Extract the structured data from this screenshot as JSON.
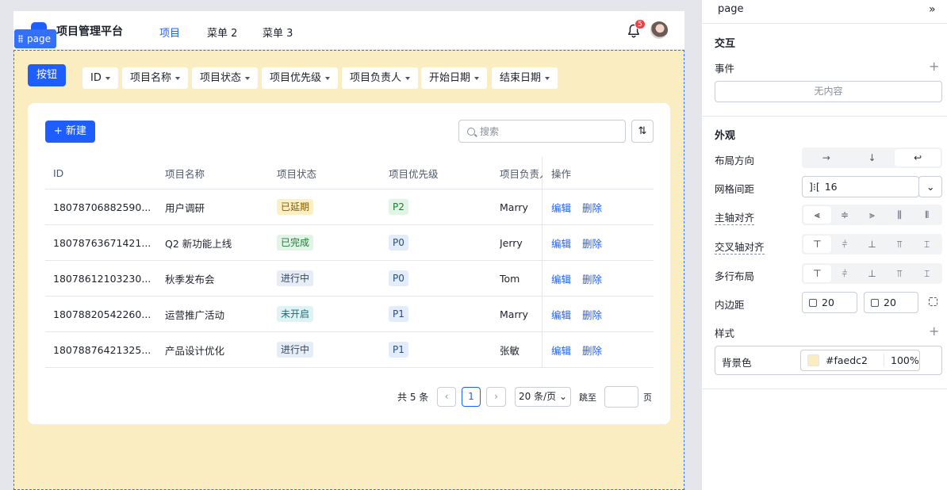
{
  "app": {
    "brand": "项目管理平台",
    "nav": [
      "项目",
      "菜单 2",
      "菜单 3"
    ],
    "active_nav": 0,
    "notification_count": "5"
  },
  "selection": {
    "tag": "page"
  },
  "toolbar": {
    "primary_button": "按钮",
    "filters": [
      "ID",
      "项目名称",
      "项目状态",
      "项目优先级",
      "项目负责人",
      "开始日期",
      "结束日期"
    ]
  },
  "table": {
    "new_button": "+ 新建",
    "search_placeholder": "搜索",
    "sort_icon": "⇅",
    "columns": [
      "ID",
      "项目名称",
      "项目状态",
      "项目优先级",
      "项目负责人",
      "操作"
    ],
    "rows": [
      {
        "id": "18078706882590...",
        "name": "用户调研",
        "status": "已延期",
        "status_type": "delay",
        "priority": "P2",
        "owner": "Marry",
        "edit": "编辑",
        "delete": "删除"
      },
      {
        "id": "18078763671421...",
        "name": "Q2 新功能上线",
        "status": "已完成",
        "status_type": "done",
        "priority": "P0",
        "owner": "Jerry",
        "edit": "编辑",
        "delete": "删除"
      },
      {
        "id": "18078612103230...",
        "name": "秋季发布会",
        "status": "进行中",
        "status_type": "doing",
        "priority": "P0",
        "owner": "Tom",
        "edit": "编辑",
        "delete": "删除"
      },
      {
        "id": "18078820542260...",
        "name": "运营推广活动",
        "status": "未开启",
        "status_type": "todo",
        "priority": "P1",
        "owner": "Marry",
        "edit": "编辑",
        "delete": "删除"
      },
      {
        "id": "18078876421325...",
        "name": "产品设计优化",
        "status": "进行中",
        "status_type": "doing",
        "priority": "P1",
        "owner": "张敏",
        "edit": "编辑",
        "delete": "删除"
      }
    ],
    "pagination": {
      "total": "共 5 条",
      "current_page": "1",
      "page_size": "20 条/页",
      "jump_label": "跳至",
      "page_suffix": "页"
    }
  },
  "panel": {
    "title": "page",
    "collapse_icon": "»",
    "interaction": {
      "heading": "交互",
      "events_label": "事件",
      "empty_text": "无内容"
    },
    "appearance": {
      "heading": "外观",
      "layout_direction": {
        "label": "布局方向",
        "options": [
          "→",
          "↓",
          "↩"
        ],
        "selected": 2
      },
      "grid_gap": {
        "label": "网格间距",
        "value": "16",
        "icon": "]⁝["
      },
      "main_axis_align": {
        "label": "主轴对齐"
      },
      "cross_axis_align": {
        "label": "交叉轴对齐"
      },
      "multi_line": {
        "label": "多行布局"
      },
      "padding": {
        "label": "内边距",
        "horizontal": "20",
        "vertical": "20"
      },
      "style": {
        "label": "样式"
      },
      "background": {
        "label": "背景色",
        "color": "#faedc2",
        "opacity": "100%"
      }
    }
  },
  "colors": {
    "accent": "#1e5eff",
    "page_background": "#faedc2",
    "badge": "#f53f3f"
  }
}
